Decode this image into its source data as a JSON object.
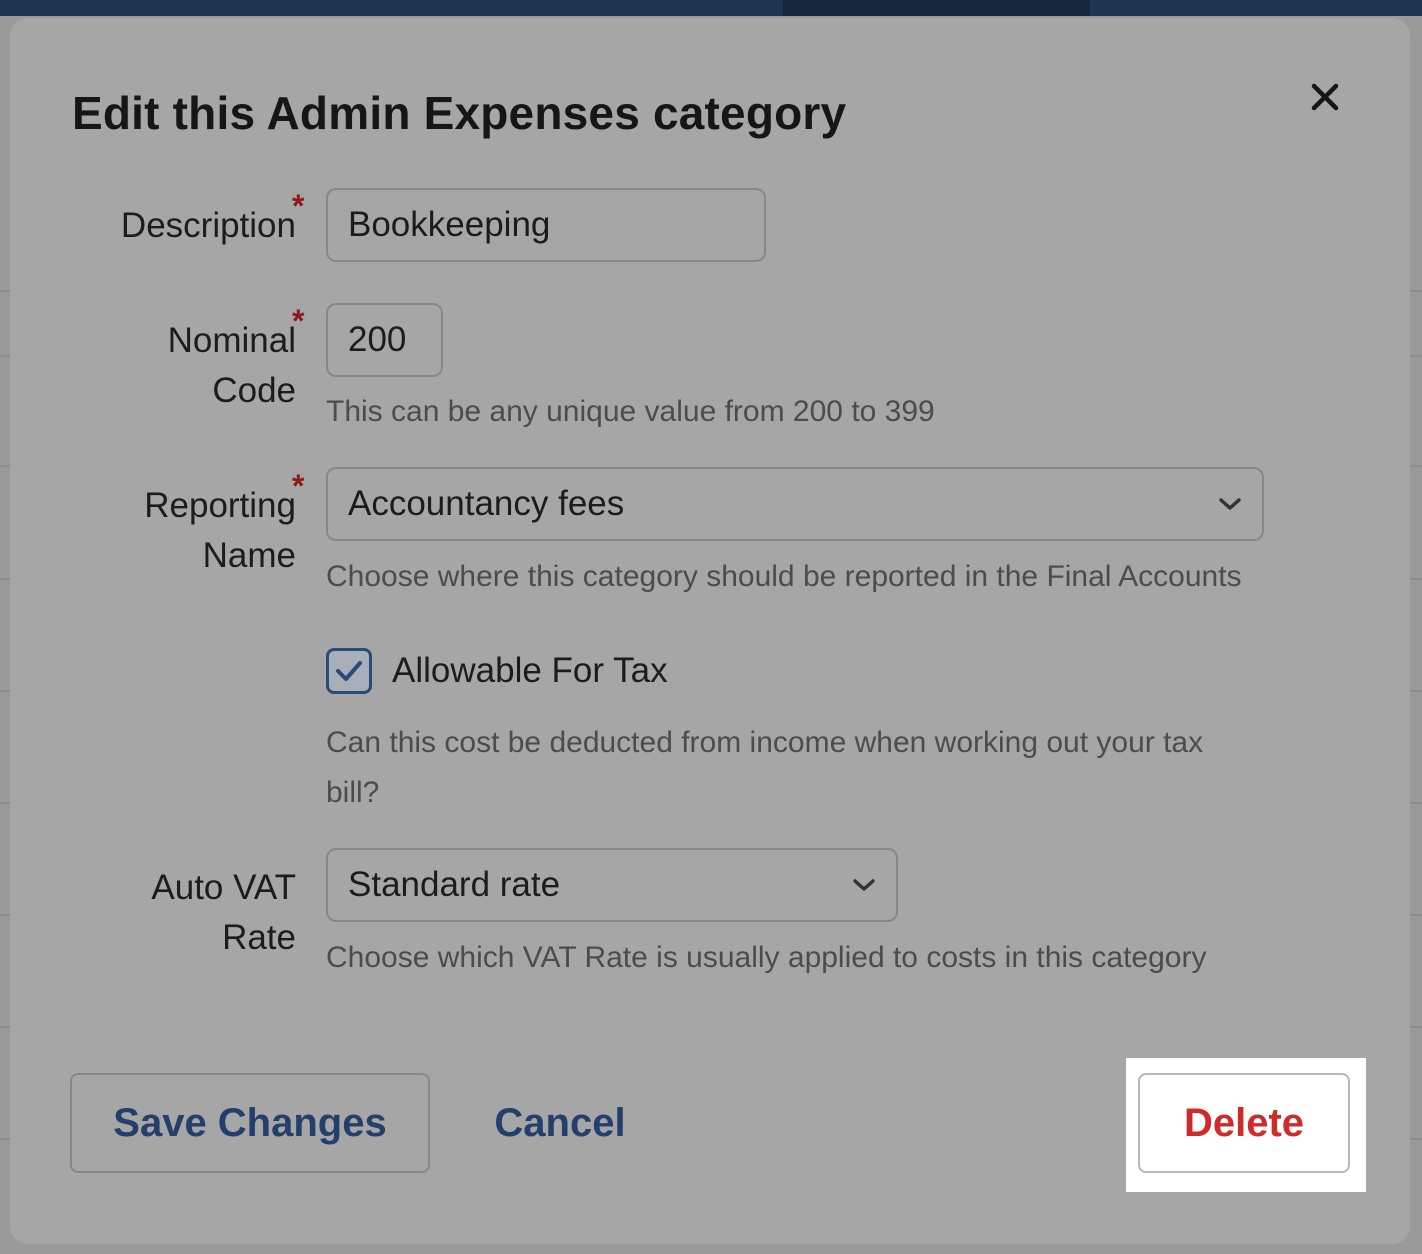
{
  "dialog": {
    "title": "Edit this Admin Expenses category",
    "close_icon": "close-icon"
  },
  "fields": {
    "description": {
      "label": "Description",
      "required": true,
      "value": "Bookkeeping"
    },
    "nominal_code": {
      "label_line1": "Nominal",
      "label_line2": "Code",
      "required": true,
      "value": "200",
      "hint": "This can be any unique value from 200 to 399"
    },
    "reporting_name": {
      "label_line1": "Reporting",
      "label_line2": "Name",
      "required": true,
      "selected": "Accountancy fees",
      "hint": "Choose where this category should be reported in the Final Accounts"
    },
    "allowable_for_tax": {
      "label": "Allowable For Tax",
      "checked": true,
      "hint_line1": "Can this cost be deducted from income when working out your tax",
      "hint_line2": "bill?"
    },
    "auto_vat_rate": {
      "label_line1": "Auto VAT",
      "label_line2": "Rate",
      "selected": "Standard rate",
      "hint": "Choose which VAT Rate is usually applied to costs in this category"
    }
  },
  "actions": {
    "save_label": "Save Changes",
    "cancel_label": "Cancel",
    "delete_label": "Delete"
  },
  "colors": {
    "link_blue": "#243f6b",
    "danger_red": "#d02b2b",
    "required_star": "#8b1b1b"
  }
}
